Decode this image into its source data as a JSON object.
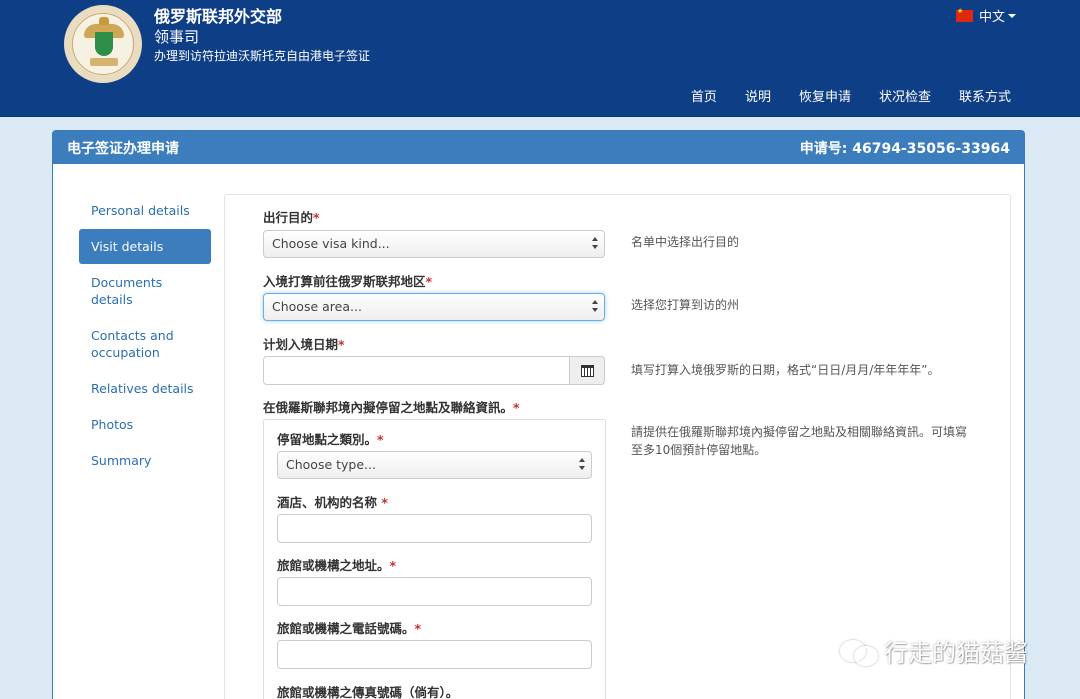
{
  "header": {
    "ministry": "俄罗斯联邦外交部",
    "department": "领事司",
    "subtitle": "办理到访符拉迪沃斯托克自由港电子签证",
    "language": "中文",
    "nav": [
      "首页",
      "说明",
      "恢复申请",
      "状况检查",
      "联系方式"
    ]
  },
  "panel": {
    "title": "电子签证办理申请",
    "application_number": "申请号: 46794-35056-33964"
  },
  "sidebar": {
    "items": [
      {
        "label": "Personal details",
        "active": false
      },
      {
        "label": "Visit details",
        "active": true
      },
      {
        "label": "Documents details",
        "active": false
      },
      {
        "label": "Contacts and occupation",
        "active": false
      },
      {
        "label": "Relatives details",
        "active": false
      },
      {
        "label": "Photos",
        "active": false
      },
      {
        "label": "Summary",
        "active": false
      }
    ]
  },
  "form": {
    "purpose": {
      "label": "出行目的",
      "placeholder": "Choose visa kind...",
      "hint": "名单中选择出行目的"
    },
    "area": {
      "label": "入境打算前往俄罗斯联邦地区",
      "placeholder": "Choose area...",
      "hint": "选择您打算到访的州"
    },
    "entry_date": {
      "label": "计划入境日期",
      "value": "",
      "hint": "填写打算入境俄罗斯的日期，格式“日日/月月/年年年年”。"
    },
    "stay": {
      "label": "在俄羅斯聯邦境內擬停留之地點及聯絡資訊。",
      "hint": "請提供在俄羅斯聯邦境內擬停留之地點及相關聯絡資訊。可填寫至多10個預計停留地點。",
      "type_label": "停留地點之類別。",
      "type_placeholder": "Choose type...",
      "name_label": "酒店、机构的名称",
      "address_label": "旅館或機構之地址。",
      "phone_label": "旅館或機構之電話號碼。",
      "fax_label": "旅館或機構之傳真號碼（倘有）。"
    },
    "required_mark": "*"
  },
  "watermark": {
    "text": "行走的猫菇酱"
  },
  "colors": {
    "header_bg": "#0e3f86",
    "panel_head": "#3b7dbd",
    "link": "#2a6fb0",
    "required": "#c9302c",
    "page_bg": "#dbe9f5"
  }
}
